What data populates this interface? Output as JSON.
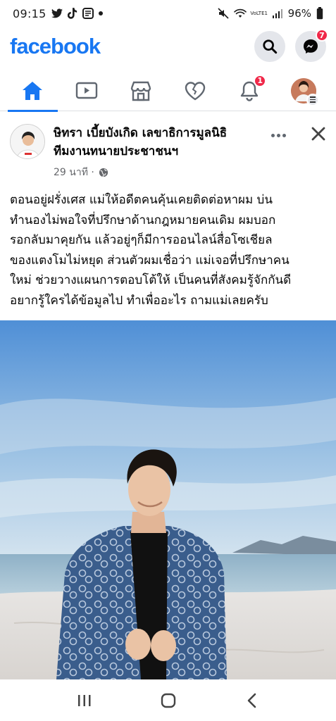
{
  "status_bar": {
    "time": "09:15",
    "network_label": "VoLTE1",
    "battery": "96%"
  },
  "header": {
    "logo": "facebook",
    "messenger_badge": "7"
  },
  "tabs": [
    {
      "name": "home",
      "icon": "home-icon",
      "active": true
    },
    {
      "name": "watch",
      "icon": "video-icon",
      "active": false
    },
    {
      "name": "marketplace",
      "icon": "shop-icon",
      "active": false
    },
    {
      "name": "dating",
      "icon": "heart-icon",
      "active": false
    },
    {
      "name": "notifications",
      "icon": "bell-icon",
      "active": false,
      "badge": "1"
    },
    {
      "name": "menu",
      "icon": "profile-avatar",
      "active": false
    }
  ],
  "post": {
    "author_line1": "ษิทรา เบี้ยบังเกิด เลขาธิการมูลนิธิ",
    "author_line2": "ทีมงานทนายประชาชนฯ",
    "time": "29 นาที ·",
    "privacy_icon": "globe-icon",
    "text_lines": [
      "ตอนอยู่ฝรั่งเศส แม่ให้อดีตคนคุ้นเคยติดต่อหาผม บ่น",
      "ทำนองไม่พอใจที่ปรึกษาด้านกฎหมายคนเดิม ผมบอก",
      "รอกลับมาคุยกัน แล้วอยู่ๆก็มีการออนไลน์สื่อโซเชียล",
      "ของแตงโมไม่หยุด ส่วนตัวผมเชื่อว่า แม่เจอที่ปรึกษาคน",
      "ใหม่ ช่วยวางแผนการตอบโต้ให้ เป็นคนที่สังคมรู้จักกันดี",
      "อยากรู้ใครได้ข้อมูลไป  ทำเพื่ออะไร ถามแม่เลยครับ"
    ]
  },
  "colors": {
    "brand": "#1877f2",
    "badge": "#f02849",
    "muted": "#65676b"
  }
}
